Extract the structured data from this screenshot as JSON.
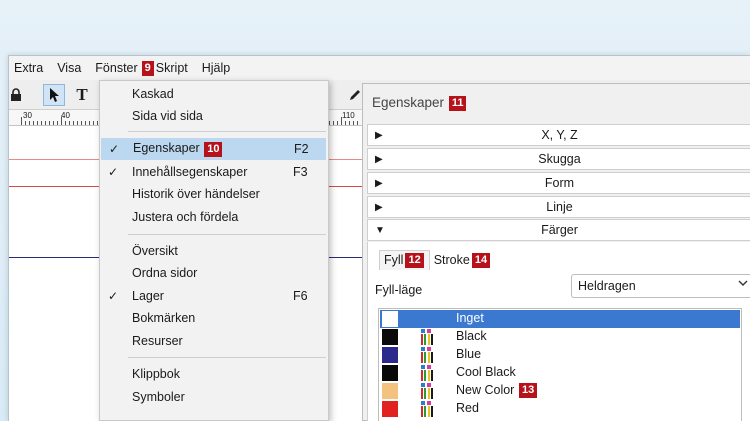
{
  "menubar": {
    "items": [
      "Extra",
      "Visa",
      "Fönster",
      "Skript",
      "Hjälp"
    ],
    "active_badge": "9"
  },
  "dropdown": {
    "items": [
      {
        "label": "Kaskad",
        "checked": false,
        "shortcut": ""
      },
      {
        "label": "Sida vid sida",
        "checked": false,
        "shortcut": ""
      },
      {
        "label": "Egenskaper",
        "checked": true,
        "shortcut": "F2",
        "badge": "10",
        "highlighted": true
      },
      {
        "label": "Innehållsegenskaper",
        "checked": true,
        "shortcut": "F3"
      },
      {
        "label": "Historik över händelser",
        "checked": false,
        "shortcut": ""
      },
      {
        "label": "Justera och fördela",
        "checked": false,
        "shortcut": ""
      },
      {
        "label": "Översikt",
        "checked": false,
        "shortcut": ""
      },
      {
        "label": "Ordna sidor",
        "checked": false,
        "shortcut": ""
      },
      {
        "label": "Lager",
        "checked": true,
        "shortcut": "F6"
      },
      {
        "label": "Bokmärken",
        "checked": false,
        "shortcut": ""
      },
      {
        "label": "Resurser",
        "checked": false,
        "shortcut": ""
      },
      {
        "label": "Klippbok",
        "checked": false,
        "shortcut": ""
      },
      {
        "label": "Symboler",
        "checked": false,
        "shortcut": ""
      }
    ],
    "check_glyph": "✓"
  },
  "ruler": {
    "labels": [
      "30",
      "40",
      "110"
    ]
  },
  "panel": {
    "title": "Egenskaper",
    "title_badge": "11",
    "sections": [
      "X, Y, Z",
      "Skugga",
      "Form",
      "Linje",
      "Färger"
    ],
    "tabs": [
      {
        "label": "Fyll",
        "badge": "12"
      },
      {
        "label": "Stroke",
        "badge": "14"
      }
    ],
    "fill_mode_label": "Fyll-läge",
    "fill_mode_value": "Heldragen",
    "colors": [
      {
        "name": "Inget",
        "swatch": "#ffffff"
      },
      {
        "name": "Black",
        "swatch": "#0a0a0a"
      },
      {
        "name": "Blue",
        "swatch": "#2b2a8c"
      },
      {
        "name": "Cool Black",
        "swatch": "#080808"
      },
      {
        "name": "New Color",
        "swatch": "#f2c27e",
        "badge": "13"
      },
      {
        "name": "Red",
        "swatch": "#e1231f"
      }
    ]
  },
  "colors": {
    "badge": "#b5121b",
    "selection": "#3b78d0",
    "highlight": "#bcd8f1"
  }
}
